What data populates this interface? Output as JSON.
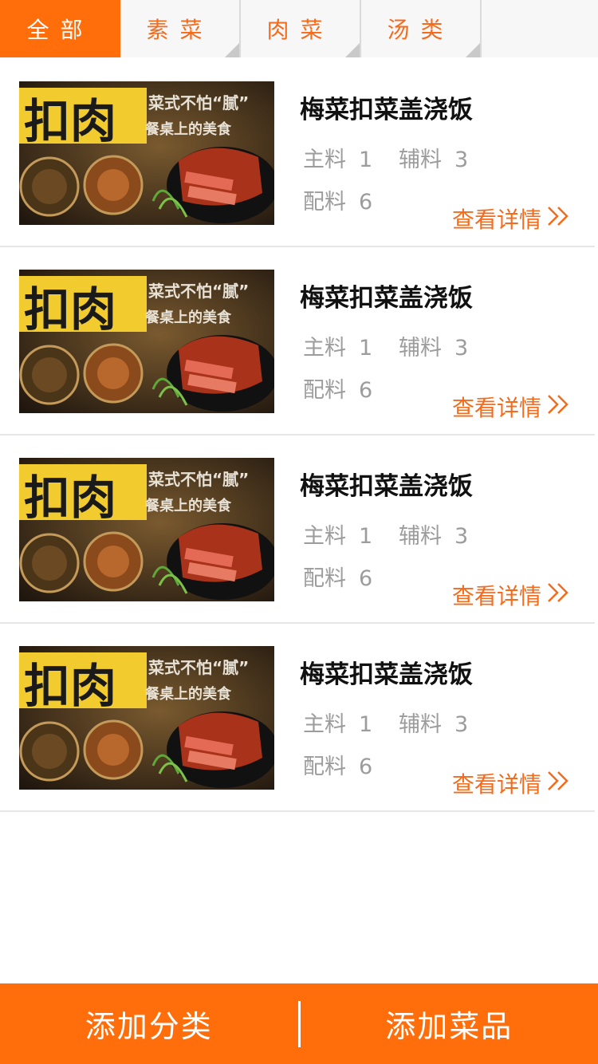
{
  "tabs": [
    {
      "label": "全部",
      "active": true
    },
    {
      "label": "素菜",
      "active": false
    },
    {
      "label": "肉菜",
      "active": false
    },
    {
      "label": "汤类",
      "active": false
    },
    {
      "label": "",
      "active": false
    }
  ],
  "items": [
    {
      "title": "梅菜扣菜盖浇饭",
      "main_label": "主料",
      "main_count": "1",
      "aux_label": "辅料",
      "aux_count": "3",
      "side_label": "配料",
      "side_count": "6",
      "detail_label": "查看详情",
      "image": {
        "big_text": "扣肉",
        "slogan": "菜式不怕“腻”",
        "sub_slogan": "餐桌上的美食"
      }
    },
    {
      "title": "梅菜扣菜盖浇饭",
      "main_label": "主料",
      "main_count": "1",
      "aux_label": "辅料",
      "aux_count": "3",
      "side_label": "配料",
      "side_count": "6",
      "detail_label": "查看详情",
      "image": {
        "big_text": "扣肉",
        "slogan": "菜式不怕“腻”",
        "sub_slogan": "餐桌上的美食"
      }
    },
    {
      "title": "梅菜扣菜盖浇饭",
      "main_label": "主料",
      "main_count": "1",
      "aux_label": "辅料",
      "aux_count": "3",
      "side_label": "配料",
      "side_count": "6",
      "detail_label": "查看详情",
      "image": {
        "big_text": "扣肉",
        "slogan": "菜式不怕“腻”",
        "sub_slogan": "餐桌上的美食"
      }
    },
    {
      "title": "梅菜扣菜盖浇饭",
      "main_label": "主料",
      "main_count": "1",
      "aux_label": "辅料",
      "aux_count": "3",
      "side_label": "配料",
      "side_count": "6",
      "detail_label": "查看详情",
      "image": {
        "big_text": "扣肉",
        "slogan": "菜式不怕“腻”",
        "sub_slogan": "餐桌上的美食"
      }
    }
  ],
  "bottom_bar": {
    "add_category": "添加分类",
    "add_dish": "添加菜品"
  },
  "colors": {
    "accent": "#ff6e0a",
    "accent_text": "#f56b1c",
    "muted_text": "#9c9c9c"
  }
}
